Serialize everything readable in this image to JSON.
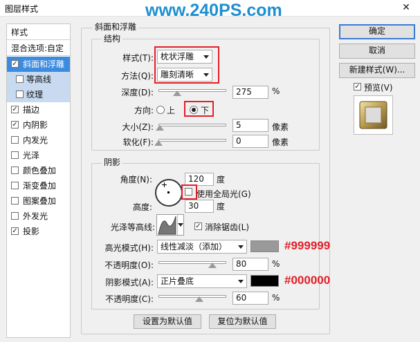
{
  "window": {
    "title": "图层样式",
    "watermark": "www.240PS.com",
    "close": "✕"
  },
  "styles_list": [
    {
      "label": "样式",
      "kind": "head"
    },
    {
      "label": "混合选项:自定",
      "kind": "head"
    },
    {
      "label": "斜面和浮雕",
      "kind": "selected",
      "checked": true
    },
    {
      "label": "等高线",
      "kind": "sub",
      "checked": false
    },
    {
      "label": "纹理",
      "kind": "sub",
      "checked": false
    },
    {
      "label": "描边",
      "checked": true
    },
    {
      "label": "内阴影",
      "checked": true
    },
    {
      "label": "内发光",
      "checked": false
    },
    {
      "label": "光泽",
      "checked": false
    },
    {
      "label": "颜色叠加",
      "checked": false
    },
    {
      "label": "渐变叠加",
      "checked": false
    },
    {
      "label": "图案叠加",
      "checked": false
    },
    {
      "label": "外发光",
      "checked": false
    },
    {
      "label": "投影",
      "checked": true
    }
  ],
  "bevel": {
    "group_title": "斜面和浮雕",
    "structure_title": "结构",
    "style_label": "样式(T):",
    "style_value": "枕状浮雕",
    "technique_label": "方法(Q):",
    "technique_value": "雕刻清晰",
    "depth_label": "深度(D):",
    "depth_value": "275",
    "depth_unit": "%",
    "depth_level": 0.275,
    "direction_label": "方向:",
    "direction_up": "上",
    "direction_down": "下",
    "size_label": "大小(Z):",
    "size_value": "5",
    "size_unit": "像素",
    "size_level": 0.02,
    "soften_label": "软化(F):",
    "soften_value": "0",
    "soften_unit": "像素",
    "soften_level": 0.0
  },
  "shading": {
    "title": "阴影",
    "angle_label": "角度(N):",
    "angle_value": "120",
    "angle_unit": "度",
    "global_light_label": "使用全局光(G)",
    "altitude_label": "高度:",
    "altitude_value": "30",
    "altitude_unit": "度",
    "gloss_label": "光泽等高线:",
    "antialias_label": "消除锯齿(L)",
    "highlight_mode_label": "高光模式(H):",
    "highlight_mode_value": "线性减淡（添加）",
    "highlight_color": "#999999",
    "highlight_color_text": "#999999",
    "highlight_opacity_label": "不透明度(O):",
    "highlight_opacity_value": "80",
    "highlight_opacity_unit": "%",
    "highlight_opacity_level": 0.8,
    "shadow_mode_label": "阴影模式(A):",
    "shadow_mode_value": "正片叠底",
    "shadow_color": "#000000",
    "shadow_color_text": "#000000",
    "shadow_opacity_label": "不透明度(C):",
    "shadow_opacity_value": "60",
    "shadow_opacity_unit": "%",
    "shadow_opacity_level": 0.6
  },
  "footer": {
    "make_default": "设置为默认值",
    "reset_default": "复位为默认值"
  },
  "right": {
    "ok": "确定",
    "cancel": "取消",
    "new_style": "新建样式(W)...",
    "preview": "预览(V)"
  }
}
